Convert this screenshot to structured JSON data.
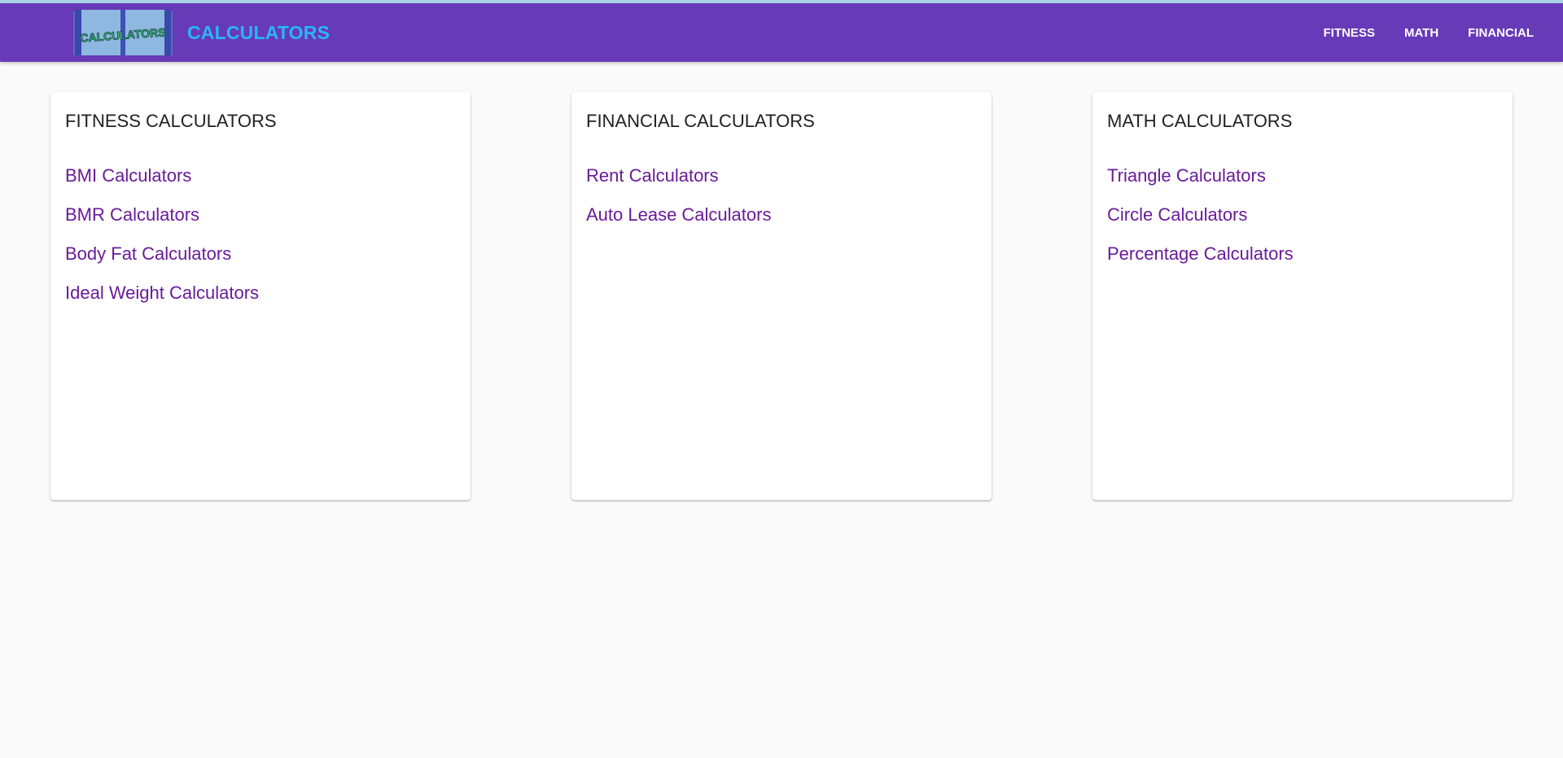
{
  "header": {
    "logo_text": "CALCULATORS",
    "brand_title": "CALCULATORS",
    "nav": [
      {
        "label": "FITNESS"
      },
      {
        "label": "MATH"
      },
      {
        "label": "FINANCIAL"
      }
    ]
  },
  "cards": [
    {
      "title": "FITNESS CALCULATORS",
      "links": [
        "BMI Calculators",
        "BMR Calculators",
        "Body Fat Calculators",
        "Ideal Weight Calculators"
      ]
    },
    {
      "title": "FINANCIAL CALCULATORS",
      "links": [
        "Rent Calculators",
        "Auto Lease Calculators"
      ]
    },
    {
      "title": "MATH CALCULATORS",
      "links": [
        "Triangle Calculators",
        "Circle Calculators",
        "Percentage Calculators"
      ]
    }
  ],
  "colors": {
    "navbar": "#673ab7",
    "brand_text": "#29b6f6",
    "link": "#6a1b9a",
    "background": "#fafafa"
  }
}
